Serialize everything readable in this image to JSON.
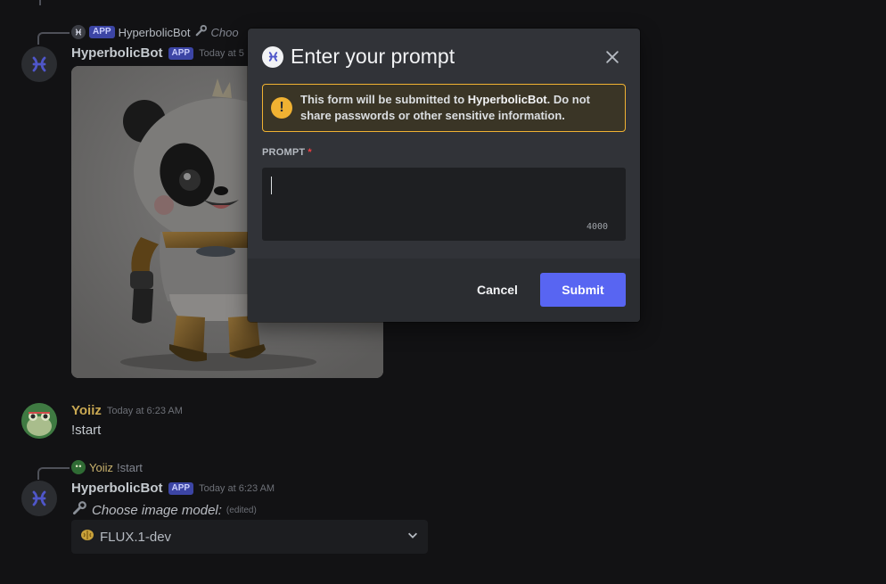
{
  "colors": {
    "accent": "#5865f2",
    "warning": "#f0b232",
    "background": "#121214",
    "modal_bg": "#313338"
  },
  "messages": {
    "bot_reply": {
      "app_badge": "APP",
      "name": "HyperbolicBot",
      "snippet": "Choo"
    },
    "bot_image_msg": {
      "username": "HyperbolicBot",
      "app_badge": "APP",
      "timestamp": "Today at 5",
      "image_icon": "panda-robot-image"
    },
    "user_msg": {
      "username": "Yoiiz",
      "timestamp": "Today at 6:23 AM",
      "text": "!start"
    },
    "bot_model_msg": {
      "reply_name": "Yoiiz",
      "reply_text": "!start",
      "username": "HyperbolicBot",
      "app_badge": "APP",
      "timestamp": "Today at 6:23 AM",
      "text": "Choose image model:",
      "edited": "(edited)",
      "text_icon": "wrench-icon",
      "select": {
        "selected": "FLUX.1-dev",
        "icon": "brain-icon"
      }
    }
  },
  "modal": {
    "title": "Enter your prompt",
    "warning": {
      "prefix": "This form will be submitted to ",
      "bot_name": "HyperbolicBot",
      "suffix": ". Do not share passwords or other sensitive information."
    },
    "field_label": "PROMPT",
    "required_mark": "*",
    "prompt_value": "",
    "char_counter": "4000",
    "cancel_label": "Cancel",
    "submit_label": "Submit"
  }
}
